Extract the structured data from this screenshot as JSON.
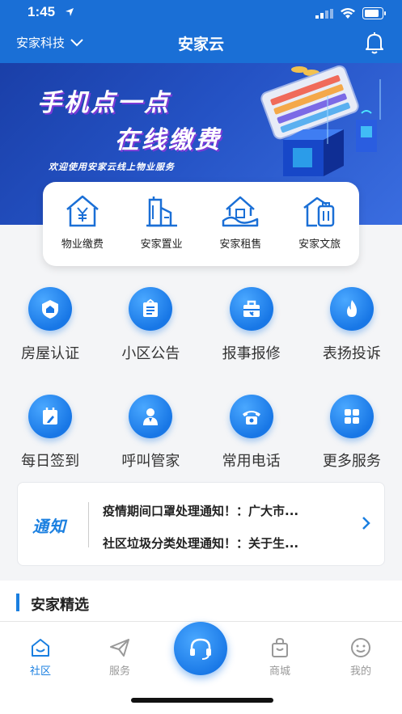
{
  "status_bar": {
    "time": "1:45"
  },
  "header": {
    "community": "安家科技",
    "title": "安家云"
  },
  "banner": {
    "line1": "手机点一点",
    "line2": "在线缴费",
    "subtitle": "欢迎使用安家云线上物业服务"
  },
  "quick_services": [
    {
      "label": "物业缴费",
      "icon": "property-fee-icon"
    },
    {
      "label": "安家置业",
      "icon": "real-estate-icon"
    },
    {
      "label": "安家租售",
      "icon": "rental-icon"
    },
    {
      "label": "安家文旅",
      "icon": "travel-icon"
    }
  ],
  "services": [
    {
      "label": "房屋认证",
      "icon": "house-shield-icon"
    },
    {
      "label": "小区公告",
      "icon": "notice-board-icon"
    },
    {
      "label": "报事报修",
      "icon": "repair-toolbox-icon"
    },
    {
      "label": "表扬投诉",
      "icon": "flame-icon"
    },
    {
      "label": "每日签到",
      "icon": "calendar-checkin-icon"
    },
    {
      "label": "呼叫管家",
      "icon": "butler-person-icon"
    },
    {
      "label": "常用电话",
      "icon": "telephone-icon"
    },
    {
      "label": "更多服务",
      "icon": "grid-more-icon"
    }
  ],
  "notice": {
    "logo": "通知",
    "items": [
      "疫情期间口罩处理通知！：广大市...",
      "社区垃圾分类处理通知！：关于生..."
    ]
  },
  "section": {
    "title": "安家精选"
  },
  "tabs": [
    {
      "label": "社区",
      "icon": "home-smile-icon",
      "active": true
    },
    {
      "label": "服务",
      "icon": "paper-plane-icon",
      "active": false
    },
    {
      "label": "",
      "icon": "headset-icon",
      "active": false
    },
    {
      "label": "商城",
      "icon": "shopping-bag-icon",
      "active": false
    },
    {
      "label": "我的",
      "icon": "smiley-icon",
      "active": false
    }
  ],
  "colors": {
    "primary": "#1a6fd6",
    "accent": "#1a7fe0",
    "tab_inactive": "#999999"
  }
}
